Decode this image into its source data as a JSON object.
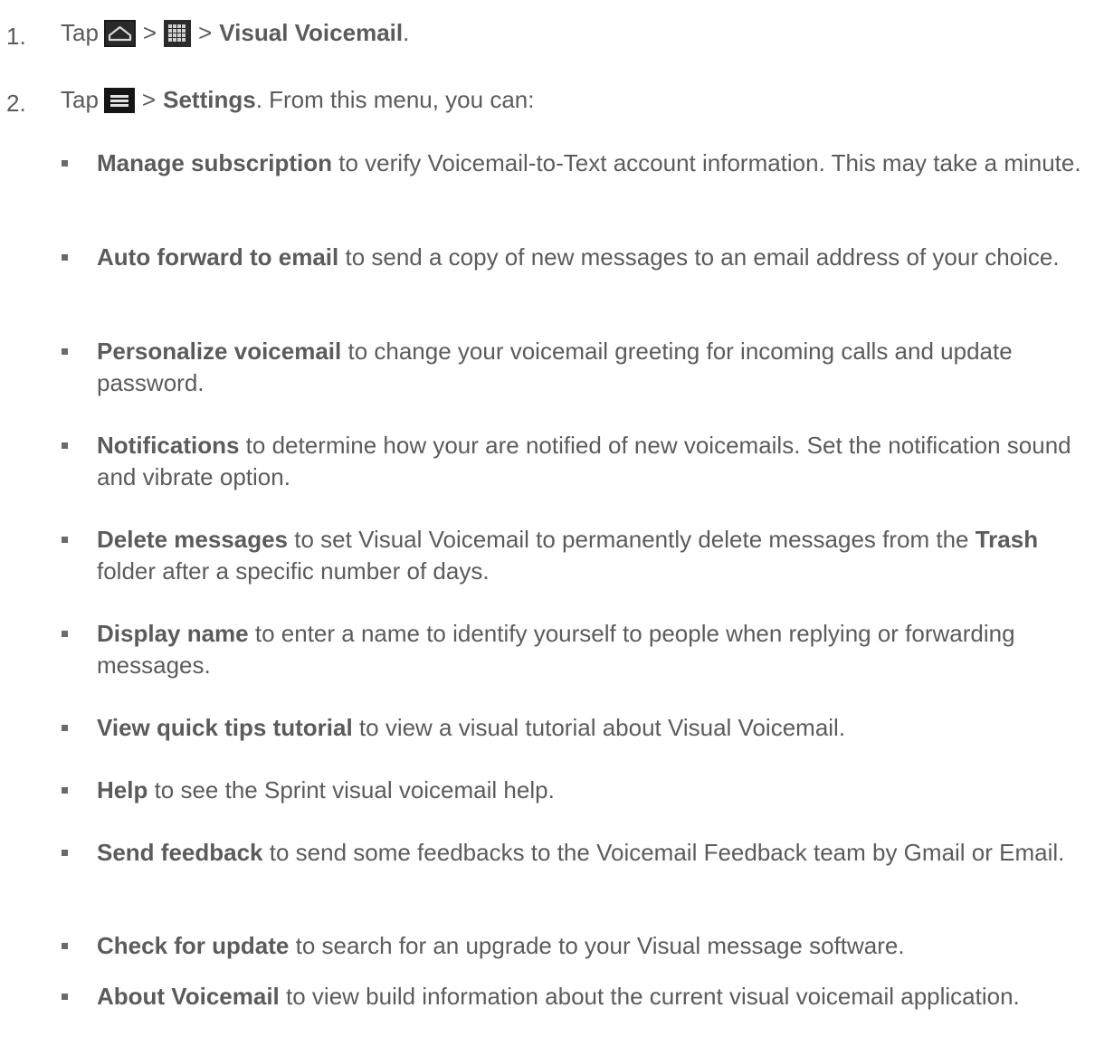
{
  "steps": [
    {
      "number": "1.",
      "prefix": "Tap",
      "sep1": ">",
      "sep2": ">",
      "target": "Visual Voicemail",
      "suffix": ".",
      "icons": [
        "home-icon",
        "apps-icon"
      ]
    },
    {
      "number": "2.",
      "prefix": "Tap",
      "sep1": ">",
      "target": "Settings",
      "suffix": ". From this menu, you can:",
      "icons": [
        "menu-icon"
      ]
    }
  ],
  "options": [
    {
      "term": "Manage subscription",
      "text": " to verify Voicemail-to-Text account information. This may take a minute."
    },
    {
      "term": "Auto forward to email",
      "text": " to send a copy of new messages to an email address of your choice."
    },
    {
      "term": "Personalize voicemail",
      "text": " to change your voicemail greeting for incoming calls and update password."
    },
    {
      "term": "Notifications",
      "text": " to determine how your are notified of new voicemails. Set the notification sound and vibrate option."
    },
    {
      "term": "Delete messages",
      "text": " to set Visual Voicemail to permanently delete messages from the ",
      "term2": "Trash",
      "text2": " folder after a specific number of days."
    },
    {
      "term": "Display name",
      "text": " to enter a name to identify yourself to people when replying or forwarding messages."
    },
    {
      "term": "View quick tips tutorial",
      "text": " to view a visual tutorial about Visual Voicemail."
    },
    {
      "term": "Help",
      "text": " to see the Sprint visual voicemail help."
    },
    {
      "term": "Send feedback",
      "text": " to send some feedbacks to the Voicemail Feedback team by Gmail or Email."
    },
    {
      "term": "Check for update",
      "text": " to search for an upgrade to your Visual message software."
    },
    {
      "term": "About Voicemail",
      "text": " to view build information about the current visual voicemail application."
    }
  ],
  "colors": {
    "text": "#5b5b5b",
    "bullet": "#6a6a6a",
    "icon_background": "#1e1e1e"
  }
}
